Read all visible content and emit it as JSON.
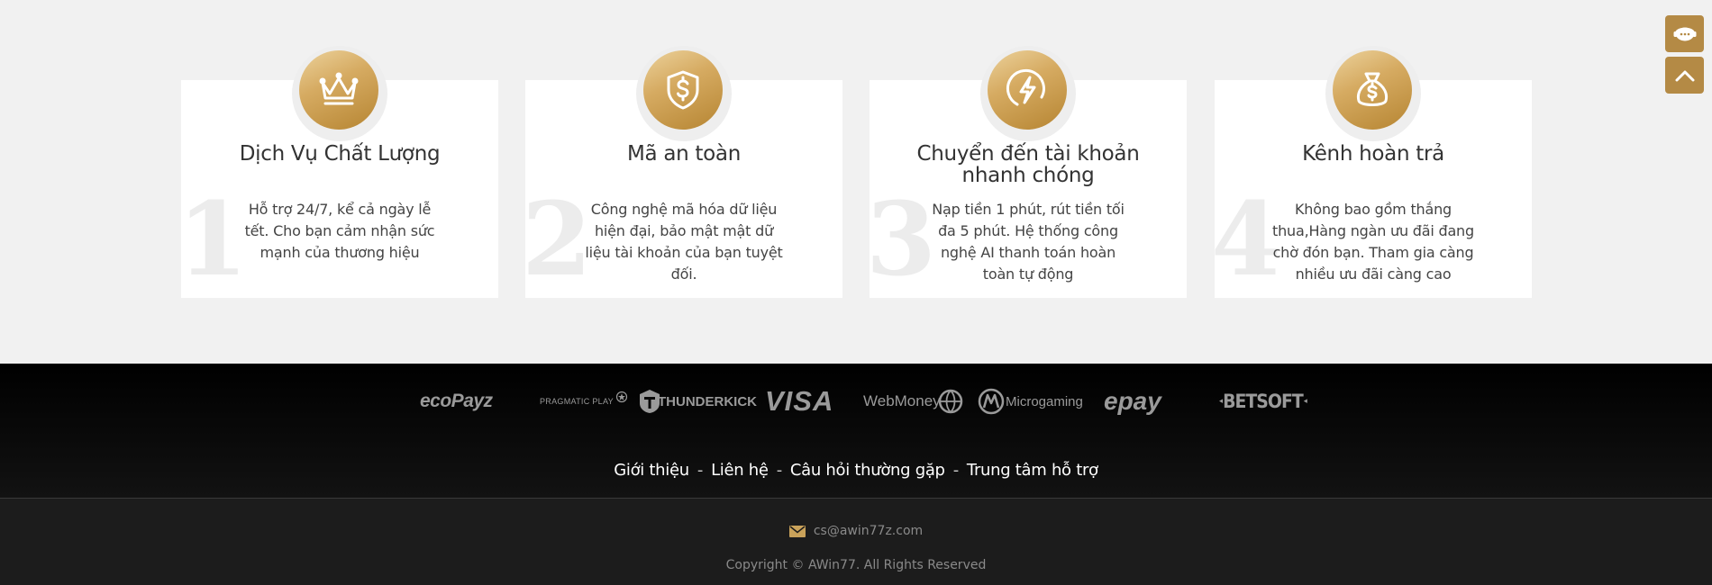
{
  "features": [
    {
      "number": "1",
      "icon": "crown-icon",
      "title": "Dịch Vụ Chất Lượng",
      "description": "Hỗ trợ 24/7, kể cả ngày lễ tết. Cho bạn cảm nhận sức mạnh của thương hiệu"
    },
    {
      "number": "2",
      "icon": "shield-dollar-icon",
      "title": "Mã an toàn",
      "description": "Công nghệ mã hóa dữ liệu hiện đại, bảo mật mật dữ liệu tài khoản của bạn tuyệt đối."
    },
    {
      "number": "3",
      "icon": "lightning-icon",
      "title": "Chuyển đến tài khoản nhanh chóng",
      "description": "Nạp tiền 1 phút, rút tiền tối đa 5 phút. Hệ thống công nghệ AI thanh toán hoàn toàn tự động"
    },
    {
      "number": "4",
      "icon": "money-bag-icon",
      "title": "Kênh hoàn trả",
      "description": "Không bao gồm thắng thua,Hàng ngàn ưu đãi đang chờ đón bạn. Tham gia càng nhiều ưu đãi càng cao"
    }
  ],
  "side_buttons": {
    "support_icon": "headset-chat-icon",
    "top_icon": "chevron-up-icon"
  },
  "partners": [
    "ecoPayz",
    "PRAGMATIC PLAY",
    "THUNDERKICK",
    "VISA",
    "WebMoney",
    "Microgaming",
    "epay",
    "BETSOFT"
  ],
  "footer": {
    "links": [
      "Giới thiệu",
      "Liên hệ",
      "Câu hỏi thường gặp",
      "Trung tâm hỗ trợ"
    ],
    "separator": "-",
    "email": "cs@awin77z.com",
    "email_icon": "envelope-icon",
    "copyright": "Copyright © AWin77. All Rights Reserved"
  },
  "colors": {
    "accent_gold": "#b48a45",
    "footer_bg": "#0b0b0b",
    "page_bg": "#f1f1f1"
  }
}
